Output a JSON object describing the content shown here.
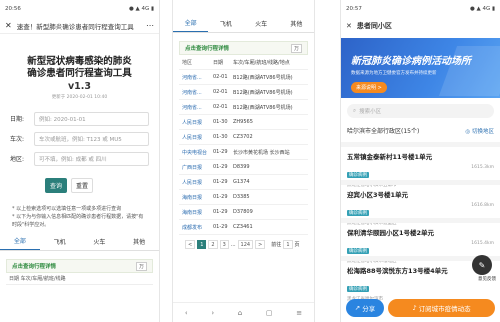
{
  "phone1": {
    "status_left": "20:56",
    "status_right": "● ▲ 4G ▮",
    "window_title": "速查！新型肺炎确诊患者同行程查询工具",
    "title_line1": "新型冠状病毒感染的肺炎",
    "title_line2": "确诊患者同行程查询工具",
    "version": "v1.3",
    "updated": "更新于 2020-02-01 10:40",
    "fields": [
      {
        "label": "日期:",
        "placeholder": "例如: 2020-01-01"
      },
      {
        "label": "车次:",
        "placeholder": "车次或航班，例如: T123 或 MU5"
      },
      {
        "label": "地区:",
        "placeholder": "可不填，例如: 成都 或 四川"
      }
    ],
    "query_btn": "查询",
    "reset_btn": "重置",
    "note1": "* 以上检索选项可以选填任意一项或多项进行查询",
    "note2": "* 以下为与你输入信息相匹配的确诊患者行程数据，请按\"有时段\"科学应对。",
    "tabs": [
      "全部",
      "飞机",
      "火车",
      "其他"
    ],
    "section_title": "点击查询行程详情",
    "section_badge": "万",
    "table_head": "日期 车次/车厢/航班/线路"
  },
  "phone2": {
    "status_left": "20:55",
    "status_right": "● ▲ 4G ▮",
    "window_title": "速查！新型肺炎确诊患者同行程查询工具",
    "tabs": [
      "全部",
      "飞机",
      "火车",
      "其他"
    ],
    "section_title": "点击查询行程详情",
    "section_badge": "万",
    "table_head": [
      "地区",
      "日期",
      "车次/车厢/航班/线路/地点"
    ],
    "rows": [
      {
        "region": "河南省...",
        "date": "02-01",
        "route": "B12路(西湖ATV86号机场)"
      },
      {
        "region": "河南省...",
        "date": "02-01",
        "route": "B12路(西湖ATV86号机场)"
      },
      {
        "region": "河南省...",
        "date": "02-01",
        "route": "B12路(西湖ATV86号机场)"
      },
      {
        "region": "人民日报",
        "date": "01-30",
        "route": "ZH9565"
      },
      {
        "region": "人民日报",
        "date": "01-30",
        "route": "CZ3702"
      },
      {
        "region": "中央电视台",
        "date": "01-29",
        "route": "长沙市黄花机场 长沙西站"
      },
      {
        "region": "广西日报",
        "date": "01-29",
        "route": "D8399"
      },
      {
        "region": "人民日报",
        "date": "01-29",
        "route": "G1374"
      },
      {
        "region": "海南日报",
        "date": "01-29",
        "route": "D3385"
      },
      {
        "region": "海南日报",
        "date": "01-29",
        "route": "D37809"
      },
      {
        "region": "成都发布",
        "date": "01-29",
        "route": "CZ3461"
      }
    ],
    "pages": [
      "<",
      "1",
      "2",
      "3",
      "...",
      "124",
      ">"
    ],
    "page_jump": "前往",
    "page_input": "1",
    "page_unit": "页"
  },
  "phone3": {
    "status_left": "20:57",
    "status_right": "● ▲ 4G ▮",
    "title": "患者同小区",
    "hero_title": "新冠肺炎确诊病例活动场所",
    "hero_sub": "数据来源为地方卫健委官方发布并持续更新",
    "hero_btn": "来源说明 >",
    "search_placeholder": "搜索小区",
    "region": "哈尔滨市全部行政区(15个)",
    "switch": "切换地区",
    "cards": [
      {
        "name": "五常镇金泰新村11号楼1单元",
        "tag": "确诊病例",
        "addr": "黑龙江省哈尔滨市五常市",
        "dist": "1615.3km"
      },
      {
        "name": "迎宾小区3号楼1单元",
        "tag": "确诊病例",
        "addr": "黑龙江省哈尔滨市道里区",
        "dist": "1616.8km"
      },
      {
        "name": "保利清华颐园小区1号楼2单元",
        "tag": "确诊病例",
        "addr": "黑龙江省哈尔滨市松北区",
        "dist": "1615.4km"
      },
      {
        "name": "松海路88号滨悦东方13号楼4单元",
        "tag": "确诊病例",
        "addr": "黑龙江省哈尔滨市",
        "dist": ""
      }
    ],
    "fab_label": "意见反馈",
    "share_btn": "分享",
    "subscribe_btn": "订阅城市疫情动态"
  },
  "colors": {
    "primary": "#2b7f7b",
    "link": "#2a6fb0",
    "hero": "#2d63c8",
    "orange": "#f58a1f"
  }
}
